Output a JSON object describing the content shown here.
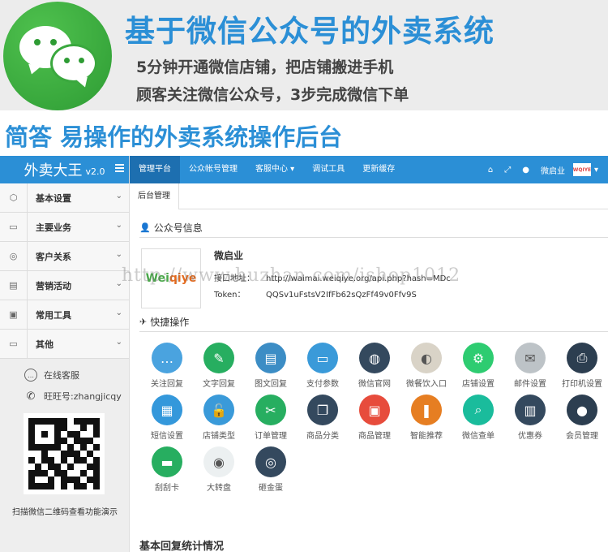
{
  "banner": {
    "title": "基于微信公众号的外卖系统",
    "sub1": "5分钟开通微信店铺，把店铺搬进手机",
    "sub2": "顾客关注微信公众号，3步完成微信下单"
  },
  "section_title": "简答  易操作的外卖系统操作后台",
  "sidebar": {
    "brand": "外卖大王",
    "version": "v2.0",
    "items": [
      {
        "label": "基本设置",
        "icon": "cube-icon"
      },
      {
        "label": "主要业务",
        "icon": "window-icon"
      },
      {
        "label": "客户关系",
        "icon": "support-icon"
      },
      {
        "label": "营销活动",
        "icon": "monitor-icon"
      },
      {
        "label": "常用工具",
        "icon": "chat-icon"
      },
      {
        "label": "其他",
        "icon": "desktop-icon"
      }
    ],
    "service": "在线客服",
    "wangwang": "旺旺号:zhangjicqy",
    "qr_note": "扫描微信二维码查看功能演示"
  },
  "topbar": {
    "items": [
      "管理平台",
      "公众帐号管理",
      "客服中心 ▾",
      "调试工具",
      "更新缓存"
    ],
    "user": "微启业"
  },
  "tab": "后台管理",
  "account": {
    "header": "公众号信息",
    "logo_w1": "Wei",
    "logo_w2": "qiye",
    "name": "微启业",
    "api_label": "接口地址：",
    "api_value": "http://waimai.weiqiye.org/api.php?hash=MDc",
    "token_label": "Token：",
    "token_value": "QQSv1uFstsV2IfFb62sQzFf49v0Ffv9S"
  },
  "quick": {
    "header": "快捷操作",
    "items": [
      {
        "label": "关注回复",
        "icon": "chat-bubble-icon",
        "color": "#4aa3df"
      },
      {
        "label": "文字回复",
        "icon": "note-pencil-icon",
        "color": "#27ae60"
      },
      {
        "label": "图文回复",
        "icon": "browser-icon",
        "color": "#3c8dc5"
      },
      {
        "label": "支付参数",
        "icon": "card-icon",
        "color": "#3a9ad9"
      },
      {
        "label": "微信官网",
        "icon": "globe-icon",
        "color": "#34495e"
      },
      {
        "label": "微餐饮入口",
        "icon": "palette-icon",
        "color": "#d9d3c7"
      },
      {
        "label": "店铺设置",
        "icon": "gear-icon",
        "color": "#2ecc71"
      },
      {
        "label": "邮件设置",
        "icon": "mail-icon",
        "color": "#bdc3c7"
      },
      {
        "label": "打印机设置",
        "icon": "printer-icon",
        "color": "#2c3e50"
      },
      {
        "label": "短信设置",
        "icon": "clipboard-icon",
        "color": "#3498db"
      },
      {
        "label": "店铺类型",
        "icon": "lock-icon",
        "color": "#3a9ad9"
      },
      {
        "label": "订单管理",
        "icon": "tools-icon",
        "color": "#27ae60"
      },
      {
        "label": "商品分类",
        "icon": "layers-icon",
        "color": "#34495e"
      },
      {
        "label": "商品管理",
        "icon": "photo-icon",
        "color": "#e74c3c"
      },
      {
        "label": "智能推荐",
        "icon": "bookmark-icon",
        "color": "#e67e22"
      },
      {
        "label": "微信查单",
        "icon": "search-icon",
        "color": "#1abc9c"
      },
      {
        "label": "优惠券",
        "icon": "swatch-icon",
        "color": "#34495e"
      },
      {
        "label": "会员管理",
        "icon": "user-icon",
        "color": "#2c3e50"
      },
      {
        "label": "刮刮卡",
        "icon": "money-icon",
        "color": "#27ae60"
      },
      {
        "label": "大转盘",
        "icon": "wheel-icon",
        "color": "#ecf0f1"
      },
      {
        "label": "砸金蛋",
        "icon": "rings-icon",
        "color": "#34495e"
      }
    ]
  },
  "stats_title": "基本回复统计情况",
  "watermark": "http://www.huzhan.com/ishop1012"
}
